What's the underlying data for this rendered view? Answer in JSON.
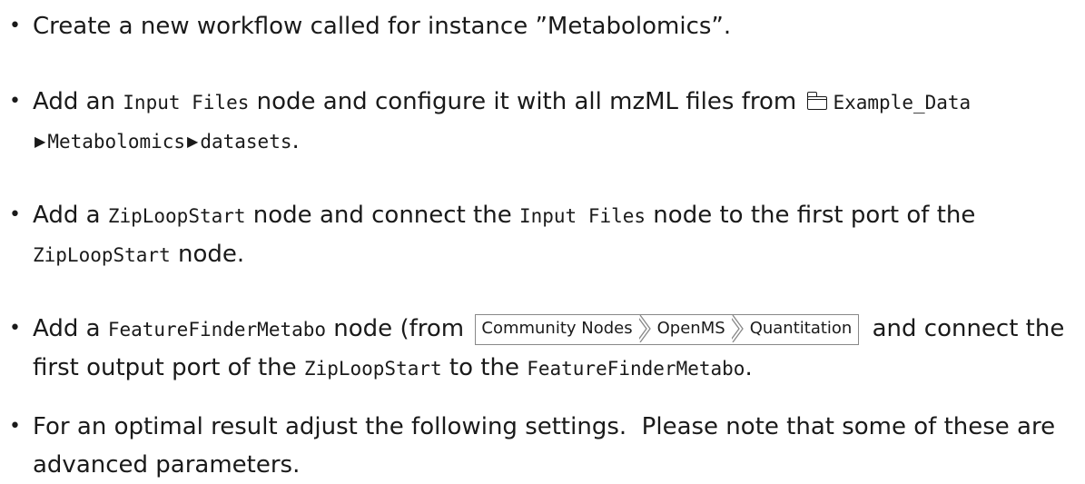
{
  "steps": [
    {
      "text": "Create a new workflow called for instance ”Metabolomics”."
    },
    {
      "pre": "Add an ",
      "code1": "Input Files",
      "mid": " node and configure it with all mzML files from ",
      "path": [
        "Example_Data",
        "Metabolomics",
        "datasets"
      ],
      "post": "."
    },
    {
      "pre": "Add a ",
      "code1": "ZipLoopStart",
      "mid1": " node and connect the ",
      "code2": "Input Files",
      "mid2": " node to the first port of the ",
      "code3": "ZipLoopStart",
      "post": " node."
    },
    {
      "pre": "Add a ",
      "code1": "FeatureFinderMetabo",
      "mid1": " node (from ",
      "menu": [
        "Community Nodes",
        "OpenMS",
        "Quantitation"
      ],
      "mid2": " and connect the first output port of the ",
      "code2": "ZipLoopStart",
      "mid3": " to the ",
      "code3": "FeatureFinderMetabo",
      "post": "."
    },
    {
      "text": "For an optimal result adjust the following settings.  Please note that some of these are advanced parameters."
    }
  ],
  "bullet": "•",
  "icons": {
    "folder": "folder-icon",
    "arrow": "triangle-right-icon"
  }
}
